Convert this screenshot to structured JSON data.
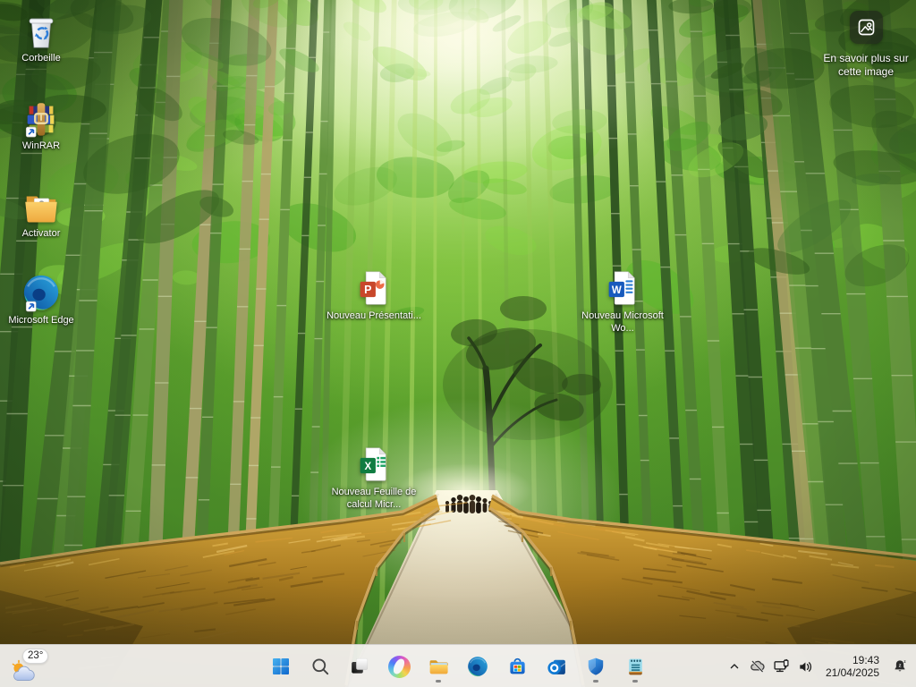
{
  "desktop": {
    "icons": [
      {
        "name": "recycle-bin",
        "label": "Corbeille"
      },
      {
        "name": "winrar",
        "label": "WinRAR"
      },
      {
        "name": "activator",
        "label": "Activator"
      },
      {
        "name": "microsoft-edge",
        "label": "Microsoft Edge"
      },
      {
        "name": "new-powerpoint",
        "label": "Nouveau Présentati..."
      },
      {
        "name": "new-word",
        "label": "Nouveau Microsoft Wo..."
      },
      {
        "name": "new-excel",
        "label": "Nouveau Feuille de calcul Micr..."
      }
    ],
    "spotlight": {
      "label": "En savoir plus sur cette image"
    }
  },
  "taskbar": {
    "weather": {
      "temperature": "23°"
    },
    "buttons": [
      {
        "icon": "start"
      },
      {
        "icon": "search"
      },
      {
        "icon": "task-view"
      },
      {
        "icon": "copilot"
      },
      {
        "icon": "file-explorer",
        "running": true
      },
      {
        "icon": "edge"
      },
      {
        "icon": "microsoft-store"
      },
      {
        "icon": "outlook"
      },
      {
        "icon": "windows-security",
        "running": true
      },
      {
        "icon": "notepad",
        "running": true
      }
    ],
    "tray": {
      "icons": [
        "chevron-up",
        "onedrive-offline",
        "network-ethernet",
        "volume"
      ],
      "clock": {
        "time": "19:43",
        "date": "21/04/2025"
      },
      "notification": "do-not-disturb-bell"
    }
  },
  "colors": {
    "taskbar_bg": "#f3f2f0",
    "selection_blue": "#0078d4",
    "label_text": "#ffffff"
  }
}
